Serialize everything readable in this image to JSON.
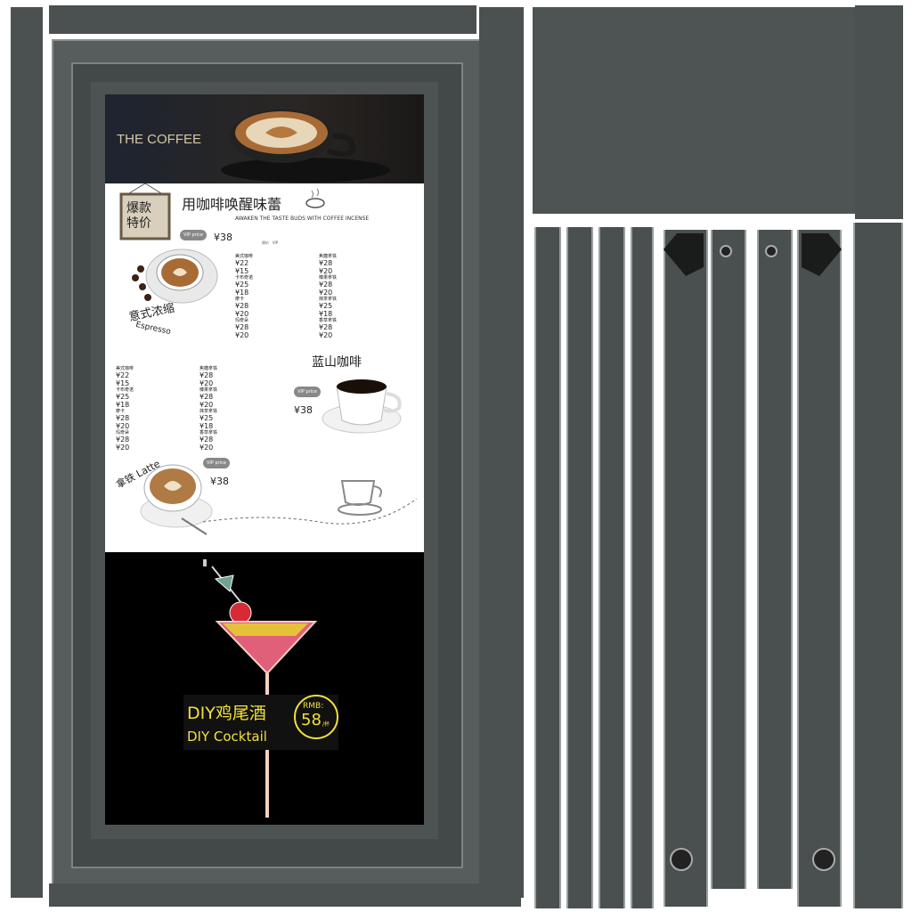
{
  "menu": {
    "top_title": "THE COFFEE",
    "sign_label": "爆款特价",
    "headline_cn": "用咖啡唤醒味蕾",
    "headline_en": "AWAKEN THE TASTE BUDS WITH COFFEE INCENSE",
    "vip_label": "VIP price",
    "price_38": "¥38",
    "espresso_cn": "意式浓缩",
    "espresso_en": "Espresso",
    "blue_mountain_cn": "蓝山咖啡",
    "latte_label": "拿铁 Latte",
    "table1": [
      {
        "name": "美式咖啡",
        "price": "¥22",
        "vip": "¥15"
      },
      {
        "name": "卡布奇诺",
        "price": "¥25",
        "vip": "¥18"
      },
      {
        "name": "摩卡",
        "price": "¥28",
        "vip": "¥20"
      },
      {
        "name": "玛奇朵",
        "price": "¥28",
        "vip": "¥20"
      }
    ],
    "table2": [
      {
        "name": "焦糖拿铁",
        "price": "¥28",
        "vip": "¥20"
      },
      {
        "name": "榛果拿铁",
        "price": "¥28",
        "vip": "¥20"
      },
      {
        "name": "抹茶拿铁",
        "price": "¥25",
        "vip": "¥18"
      },
      {
        "name": "香草拿铁",
        "price": "¥28",
        "vip": "¥20"
      }
    ],
    "table3": [
      {
        "name": "美式咖啡",
        "price": "¥22",
        "vip": "¥15"
      },
      {
        "name": "卡布奇诺",
        "price": "¥25",
        "vip": "¥18"
      },
      {
        "name": "摩卡",
        "price": "¥28",
        "vip": "¥20"
      },
      {
        "name": "玛奇朵",
        "price": "¥28",
        "vip": "¥20"
      }
    ],
    "table4": [
      {
        "name": "焦糖拿铁",
        "price": "¥28",
        "vip": "¥20"
      },
      {
        "name": "榛果拿铁",
        "price": "¥28",
        "vip": "¥20"
      },
      {
        "name": "抹茶拿铁",
        "price": "¥25",
        "vip": "¥18"
      },
      {
        "name": "香草拿铁",
        "price": "¥28",
        "vip": "¥20"
      }
    ],
    "cocktail_cn": "DIY鸡尾酒",
    "cocktail_en": "DIY Cocktail",
    "cocktail_currency": "RMB:",
    "cocktail_price": "58",
    "cocktail_unit": "/杯"
  },
  "colors": {
    "frame": "#4b5050",
    "frame_edge": "#8e9494",
    "neon_yellow": "#f1e13a",
    "neon_pink": "#e0607a"
  }
}
